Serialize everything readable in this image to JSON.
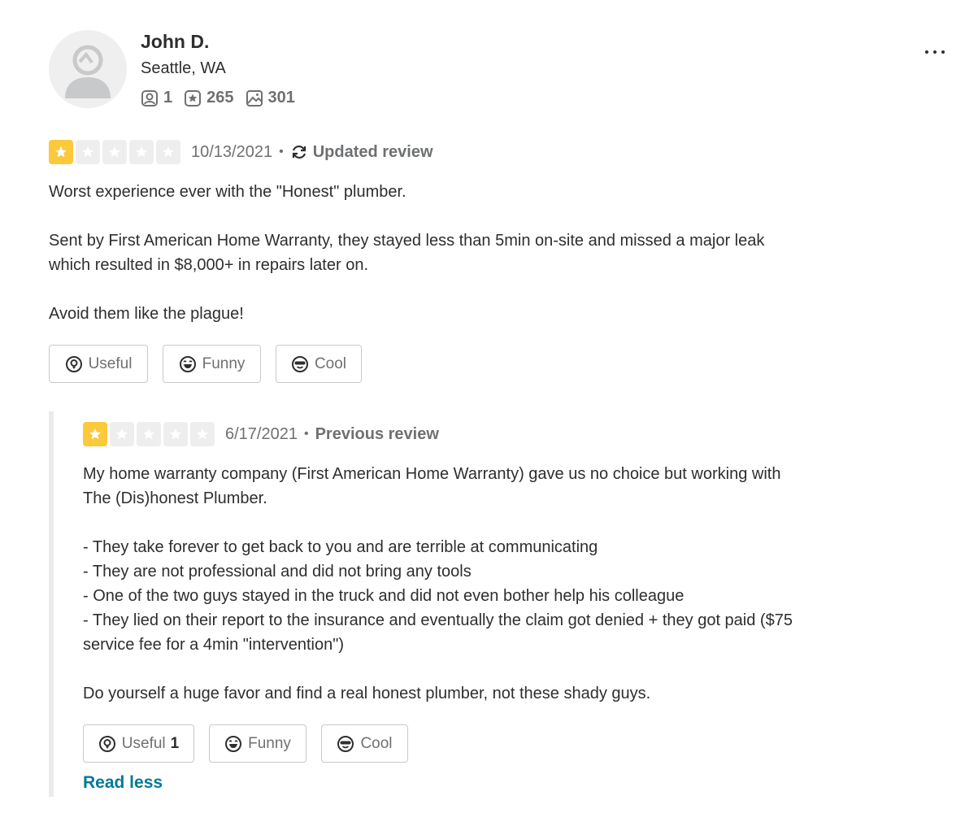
{
  "user": {
    "name": "John D.",
    "location": "Seattle, WA",
    "friends": "1",
    "reviews": "265",
    "photos": "301"
  },
  "updated_review": {
    "rating": 1,
    "date": "10/13/2021",
    "separator": "•",
    "type_label": "Updated review",
    "text": "Worst experience ever with the \"Honest\" plumber.\n\nSent by First American Home Warranty, they stayed less than 5min on-site and missed a major leak\nwhich resulted in $8,000+ in repairs later on.\n\nAvoid them like the plague!",
    "buttons": {
      "useful": "Useful",
      "funny": "Funny",
      "cool": "Cool"
    }
  },
  "previous_review": {
    "rating": 1,
    "date": "6/17/2021",
    "separator": "•",
    "type_label": "Previous review",
    "text": "My home warranty company (First American Home Warranty) gave us no choice but working with\nThe (Dis)honest Plumber.\n\n- They take forever to get back to you and are terrible at communicating\n- They are not professional and did not bring any tools\n- One of the two guys stayed in the truck and did not even bother help his colleague\n- They lied on their report to the insurance and eventually the claim got denied + they got paid ($75\nservice fee for a 4min \"intervention\")\n\nDo yourself a huge favor and find a real honest plumber, not these shady guys.",
    "buttons": {
      "useful": "Useful",
      "useful_count": "1",
      "funny": "Funny",
      "cool": "Cool"
    },
    "read_less": "Read less"
  },
  "colors": {
    "star_filled": "#fcc93a",
    "star_empty": "#eeeeee",
    "link": "#027a97",
    "muted": "#6e7072"
  }
}
